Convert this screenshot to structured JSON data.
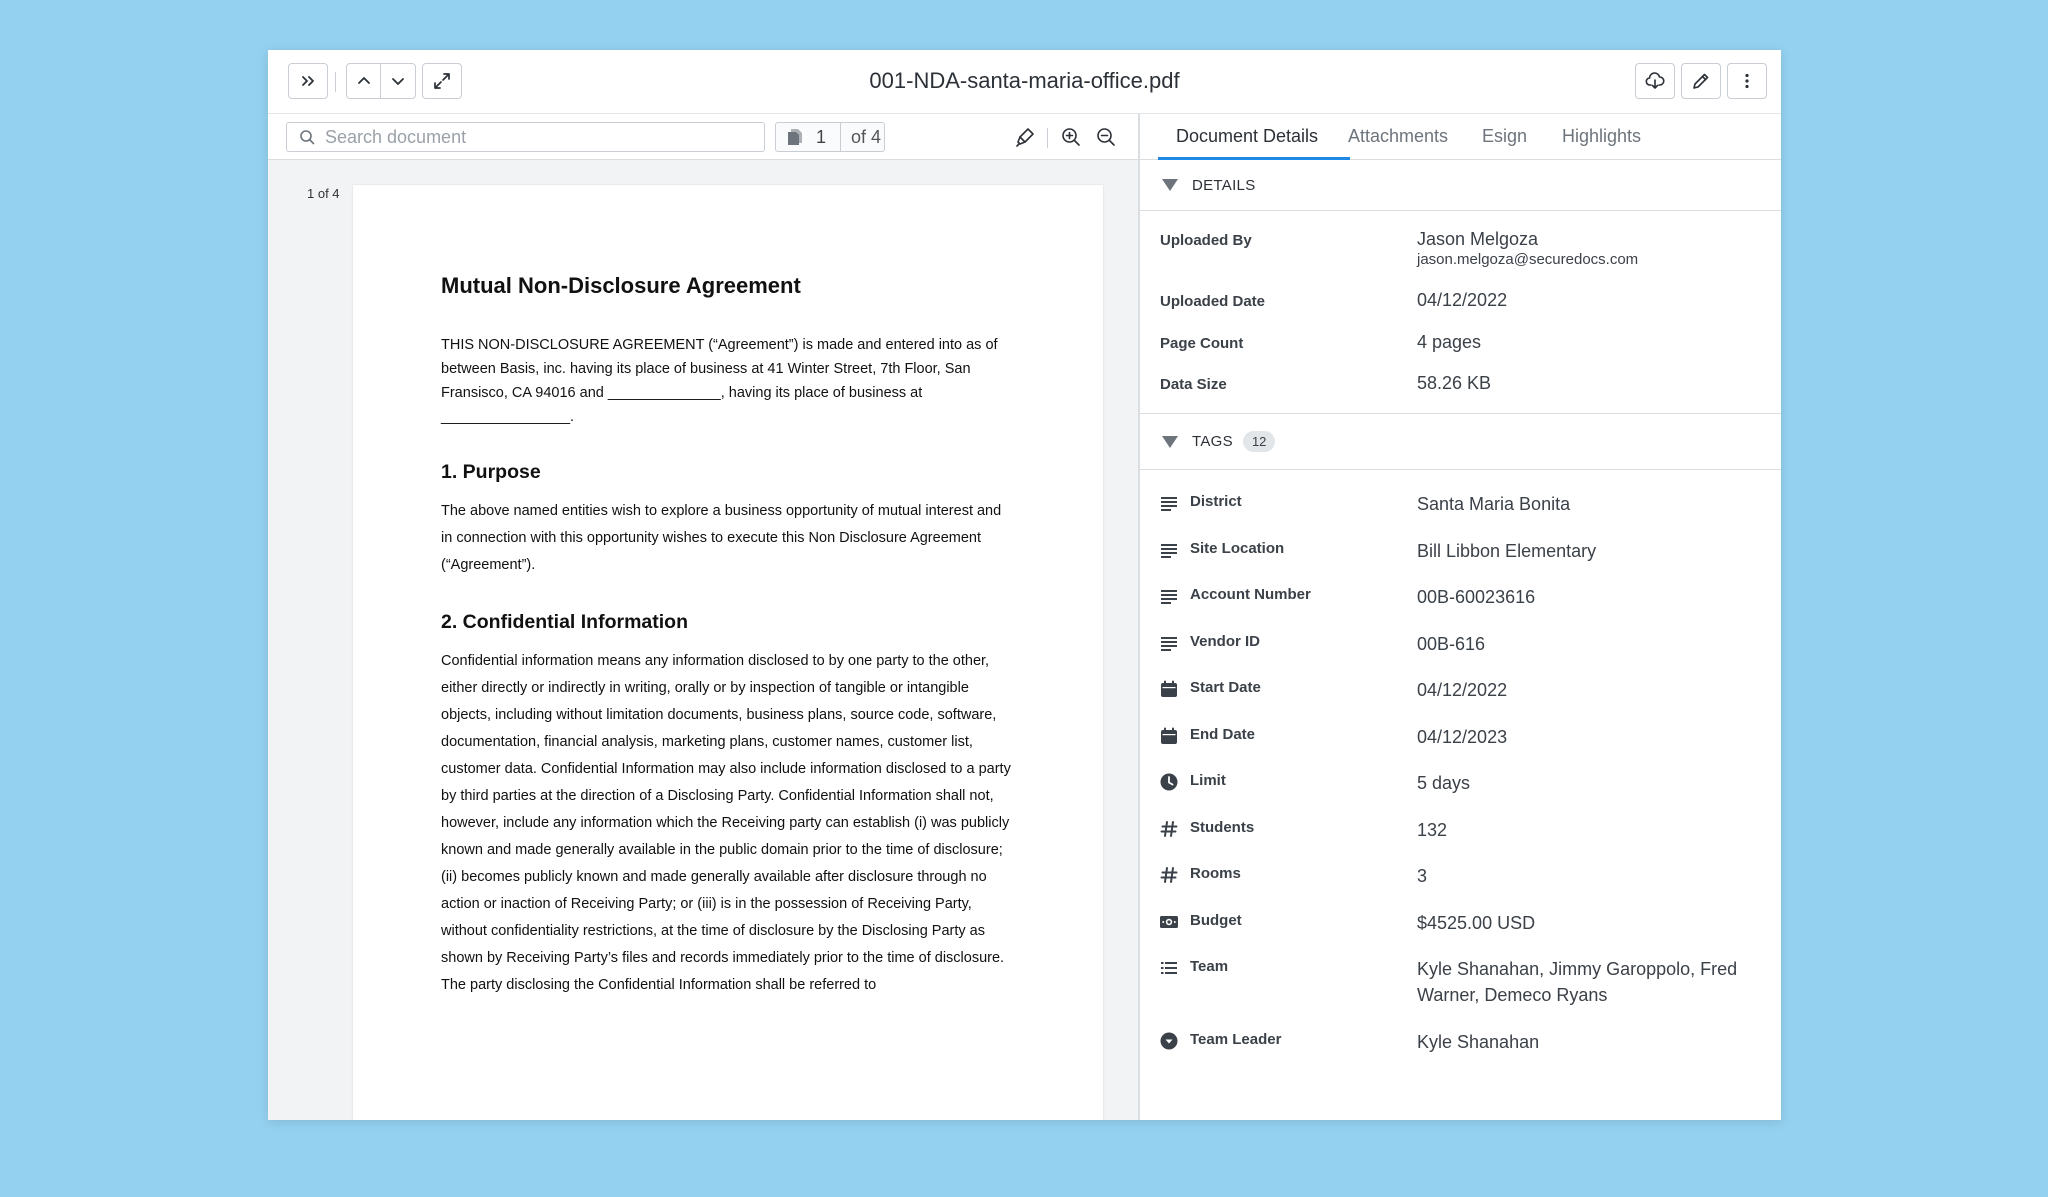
{
  "header": {
    "title": "001-NDA-santa-maria-office.pdf"
  },
  "viewer": {
    "search_placeholder": "Search document",
    "current_page": "1",
    "page_total": "of 4",
    "page_indicator": "1 of 4"
  },
  "document": {
    "title": "Mutual Non-Disclosure Agreement",
    "intro": "THIS NON-DISCLOSURE AGREEMENT (“Agreement”) is made and entered into as of between Basis, inc. having its place of business at 41 Winter Street, 7th Floor, San Fransisco, CA 94016 and ______________, having its place of business at ________________.",
    "section1_heading": "1. Purpose",
    "section1_body": "The above named entities wish to explore a business opportunity of mutual interest and in connection with this opportunity wishes to execute this Non Disclosure Agreement (“Agreement”).",
    "section2_heading": "2. Confidential Information",
    "section2_body": "Confidential information means any information disclosed to by one party to the other, either directly or indirectly in writing, orally or by inspection of tangible or intangible objects, including without limitation documents, business plans, source code, software, documentation, financial analysis, marketing plans, customer names, customer list, customer data. Confidential Information may also include information disclosed to a party by third parties at the direction of a Disclosing Party. Confidential Information shall not, however, include any information which the Receiving party can establish (i) was publicly known and made generally available in the public domain prior to the time of disclosure; (ii) becomes publicly known and made generally available after disclosure through no action or inaction of Receiving Party; or (iii) is in the possession of Receiving Party, without confidentiality restrictions, at the time of disclosure by the Disclosing Party as shown by Receiving Party’s files and records immediately prior to the time of disclosure. The party disclosing the Confidential Information shall be referred to"
  },
  "tabs": [
    "Document Details",
    "Attachments",
    "Esign",
    "Highlights"
  ],
  "details": {
    "section_title": "DETAILS",
    "uploaded_by_label": "Uploaded By",
    "uploaded_by_name": "Jason Melgoza",
    "uploaded_by_email": "jason.melgoza@securedocs.com",
    "uploaded_date_label": "Uploaded Date",
    "uploaded_date": "04/12/2022",
    "page_count_label": "Page Count",
    "page_count": "4 pages",
    "data_size_label": "Data Size",
    "data_size": "58.26 KB"
  },
  "tags": {
    "section_title": "TAGS",
    "count": "12",
    "items": [
      {
        "icon": "text-lines-icon",
        "label": "District",
        "value": "Santa Maria Bonita"
      },
      {
        "icon": "text-lines-icon",
        "label": "Site Location",
        "value": "Bill Libbon Elementary"
      },
      {
        "icon": "text-lines-icon",
        "label": "Account Number",
        "value": "00B-60023616"
      },
      {
        "icon": "text-lines-icon",
        "label": "Vendor ID",
        "value": "00B-616"
      },
      {
        "icon": "calendar-icon",
        "label": "Start Date",
        "value": "04/12/2022"
      },
      {
        "icon": "calendar-icon",
        "label": "End Date",
        "value": "04/12/2023"
      },
      {
        "icon": "clock-icon",
        "label": "Limit",
        "value": "5 days"
      },
      {
        "icon": "hash-icon",
        "label": "Students",
        "value": "132"
      },
      {
        "icon": "hash-icon",
        "label": "Rooms",
        "value": "3"
      },
      {
        "icon": "money-icon",
        "label": "Budget",
        "value": "$4525.00 USD"
      },
      {
        "icon": "list-icon",
        "label": "Team",
        "value": "Kyle Shanahan, Jimmy Garoppolo, Fred Warner, Demeco Ryans"
      },
      {
        "icon": "dropdown-circle-icon",
        "label": "Team Leader",
        "value": "Kyle Shanahan"
      }
    ]
  },
  "colors": {
    "background": "#94d1f0",
    "accent": "#1e88e5"
  }
}
